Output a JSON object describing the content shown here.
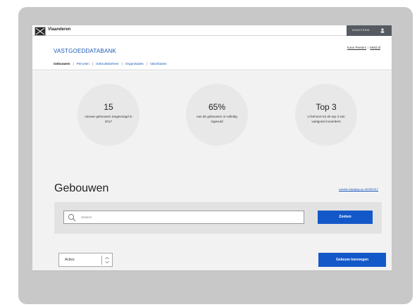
{
  "topbar": {
    "brand": "Vlaanderen",
    "account_label": "MINISTERIE"
  },
  "header": {
    "site_title": "VASTGOEDDATABANK",
    "user_name": "Koen Peeters",
    "logout_label": "Meld af",
    "separator": "|"
  },
  "nav": {
    "items": [
      {
        "label": "Gebouwen",
        "active": true
      },
      {
        "label": "Percelen",
        "active": false
      },
      {
        "label": "Gebruiksbeheer",
        "active": false
      },
      {
        "label": "Organisaties",
        "active": false
      },
      {
        "label": "Valoribaties",
        "active": false
      }
    ],
    "separator": "|"
  },
  "stats": [
    {
      "value": "15",
      "desc": "nieuwe gebouwen toegevoegd in 2017"
    },
    {
      "value": "65%",
      "desc": "van de gebouwen is volledig ingevuld"
    },
    {
      "value": "Top 3",
      "desc": "U behoort tot de top 3 van vastgoed invoerders"
    }
  ],
  "section": {
    "title": "Gebouwen",
    "link": "Laatste wijziging op 16/08/2017"
  },
  "search": {
    "placeholder": "Zoeken",
    "button_label": "Zoeken"
  },
  "actions": {
    "select_value": "Acties",
    "add_button_label": "Gebouw toevoegen"
  },
  "colors": {
    "primary": "#1358c8",
    "link": "#1b58b8",
    "stat_circle": "#e8e8e8",
    "panel": "#f2f2f2",
    "topbar_dark": "#555b61"
  }
}
